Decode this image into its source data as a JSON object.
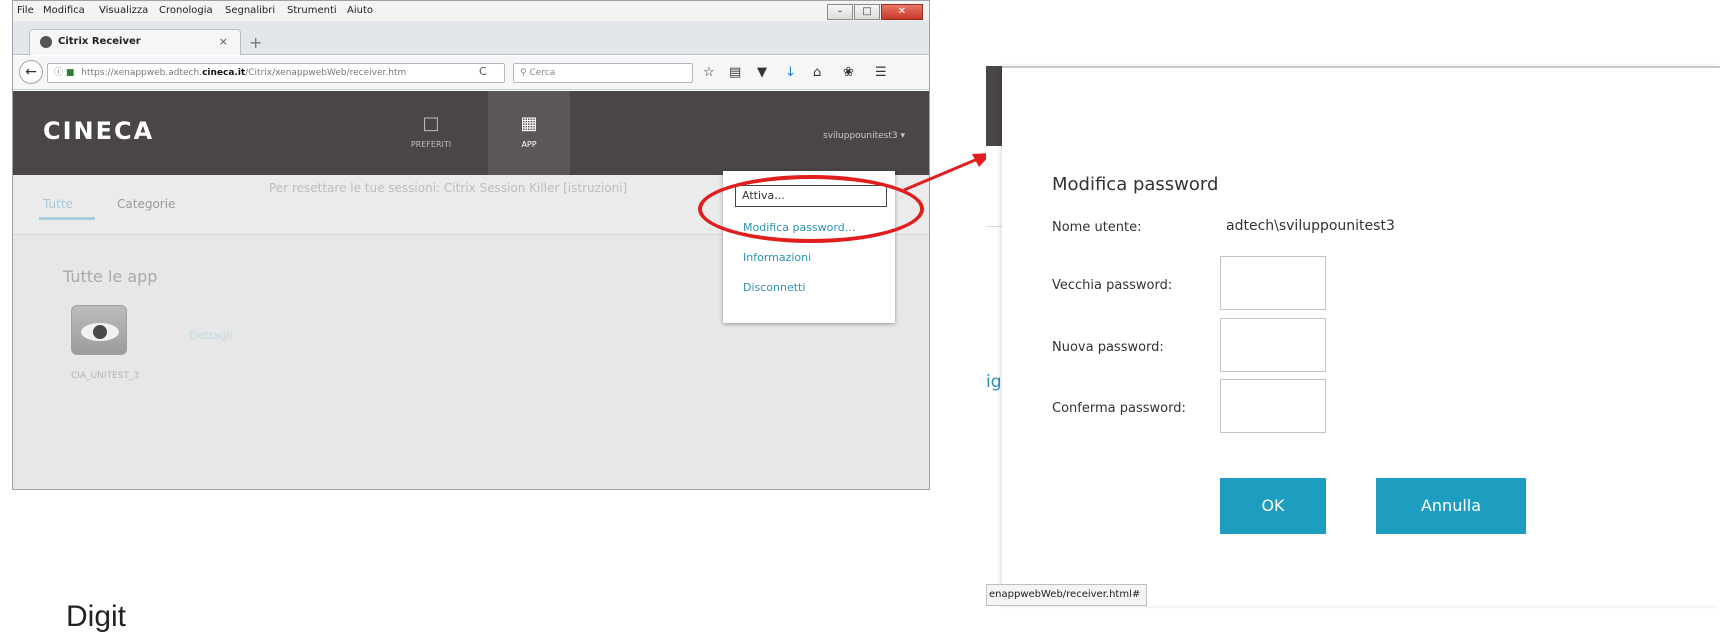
{
  "menubar": {
    "items": [
      "File",
      "Modifica",
      "Visualizza",
      "Cronologia",
      "Segnalibri",
      "Strumenti",
      "Aiuto"
    ]
  },
  "window_controls": {
    "minimize": "–",
    "maximize": "□",
    "close": "✕"
  },
  "browser": {
    "tab_title": "Citrix Receiver",
    "tab_close": "×",
    "new_tab": "+",
    "url_prefix": "https://xenappweb.adtech.",
    "url_domain": "cineca.it",
    "url_suffix": "/Citrix/xenappwebWeb/receiver.htm",
    "reload": "C",
    "search_placeholder": "Cerca",
    "toolbar_icons": [
      "star-icon",
      "library-icon",
      "pocket-icon",
      "download-icon",
      "home-icon",
      "addon-icon",
      "menu-icon"
    ]
  },
  "app": {
    "logo": "CINECA",
    "nav_favorites": "PREFERITI",
    "nav_app": "APP",
    "user": "sviluppounitest3",
    "tab_all": "Tutte",
    "tab_categories": "Categorie",
    "reset_message": "Per resettare le tue sessioni: Citrix Session Killer [istruzioni]",
    "all_apps_title": "Tutte le app",
    "app_name": "CIA_UNITEST_3",
    "details": "Dettagli"
  },
  "dropdown": {
    "activate": "Attiva...",
    "change_password": "Modifica password...",
    "info": "Informazioni",
    "logout": "Disconnetti"
  },
  "dialog": {
    "title": "Modifica password",
    "username_label": "Nome utente:",
    "username_value": "adtech\\sviluppounitest3",
    "old_password_label": "Vecchia password:",
    "new_password_label": "Nuova password:",
    "confirm_password_label": "Conferma password:",
    "ok": "OK",
    "cancel": "Annulla",
    "background_text": "ig"
  },
  "status_url": "enappwebWeb/receiver.html#",
  "caption": "Digit",
  "colors": {
    "accent": "#1d9dbf",
    "header": "#4a4646",
    "highlight_ring": "#e01e1e"
  }
}
